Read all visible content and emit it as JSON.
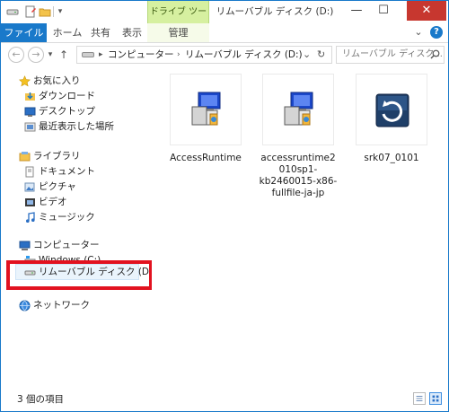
{
  "window": {
    "title": "リムーバブル ディスク (D:)"
  },
  "titlebar": {
    "contextual_tab_group": "ドライブ ツール",
    "minimize": "—",
    "maximize": "☐",
    "close": "✕"
  },
  "ribbon": {
    "tabs": [
      {
        "label": "ファイル"
      },
      {
        "label": "ホーム"
      },
      {
        "label": "共有"
      },
      {
        "label": "表示"
      },
      {
        "label": "管理"
      }
    ],
    "expand_glyph": "⌄",
    "help_glyph": "?"
  },
  "address_bar": {
    "back_glyph": "←",
    "forward_glyph": "→",
    "recent_glyph": "▾",
    "up_glyph": "↑",
    "segments": [
      "コンピューター",
      "リムーバブル ディスク (D:)"
    ],
    "chevron_glyph": "›",
    "lead_chevron_glyph": "▸",
    "dropdown_glyph": "⌄",
    "refresh_glyph": "↻"
  },
  "search": {
    "placeholder": "リムーバブル ディスク..."
  },
  "nav_pane": {
    "favorites": {
      "header": "お気に入り",
      "items": [
        "ダウンロード",
        "デスクトップ",
        "最近表示した場所"
      ]
    },
    "libraries": {
      "header": "ライブラリ",
      "items": [
        "ドキュメント",
        "ピクチャ",
        "ビデオ",
        "ミュージック"
      ]
    },
    "computer": {
      "header": "コンピューター",
      "items": [
        "Windows (C:)",
        "リムーバブル ディスク (D:)"
      ]
    },
    "network": {
      "header": "ネットワーク"
    },
    "selected_item": "リムーバブル ディスク (D:)",
    "highlight_color": "#e2121f"
  },
  "files": [
    {
      "name": "AccessRuntime",
      "icon": "installer-package-icon"
    },
    {
      "name": "accessruntime2010sp1-kb2460015-x86-fullfile-ja-jp",
      "icon": "installer-package-icon"
    },
    {
      "name": "srk07_0101",
      "icon": "restore-app-icon"
    }
  ],
  "status_bar": {
    "item_count": "3 個の項目"
  },
  "colors": {
    "accent": "#1979ca",
    "context_tab": "#d6f0a0",
    "selection": "#eaf4fc",
    "annotation_box": "#e2121f"
  }
}
